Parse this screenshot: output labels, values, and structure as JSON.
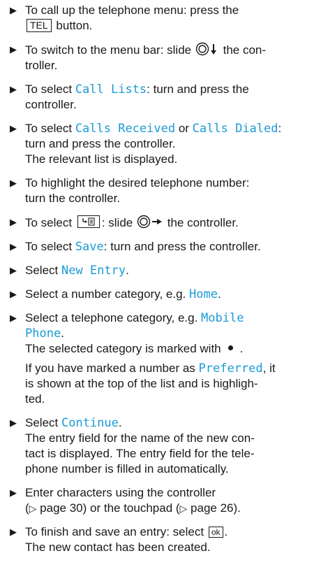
{
  "steps": [
    {
      "parts": [
        "To call up the telephone menu: press the",
        "TEL",
        "button."
      ]
    },
    {
      "parts": [
        "To switch to the menu bar: slide",
        "the con-",
        "troller."
      ]
    },
    {
      "parts": [
        "To select ",
        "Call Lists",
        ": turn and press the",
        "controller."
      ]
    },
    {
      "parts": [
        "To select ",
        "Calls Received",
        " or ",
        "Calls Dialed",
        ":",
        "turn and press the controller.",
        "The relevant list is displayed."
      ]
    },
    {
      "parts": [
        "To highlight the desired telephone number:",
        "turn the controller."
      ]
    },
    {
      "parts": [
        "To select",
        ": slide",
        "the controller."
      ]
    },
    {
      "parts": [
        "To select ",
        "Save",
        ": turn and press the controller."
      ]
    },
    {
      "parts": [
        "Select ",
        "New Entry",
        "."
      ]
    },
    {
      "parts": [
        "Select a number category, e.g. ",
        "Home",
        "."
      ]
    },
    {
      "parts": [
        "Select a telephone category, e.g. ",
        "Mobile",
        "Phone",
        ".",
        "The selected category is marked with",
        ".",
        "If you have marked a number as ",
        "Preferred",
        ", it",
        "is shown at the top of the list and is highligh-",
        "ted."
      ]
    },
    {
      "parts": [
        "Select ",
        "Continue",
        ".",
        "The entry field for the name of the new con-",
        "tact is displayed. The entry field for the tele-",
        "phone number is filled in automatically."
      ]
    },
    {
      "parts": [
        "Enter characters using the controller",
        "(",
        "▷",
        " page 30) or the touchpad (",
        "▷",
        " page 26)."
      ]
    },
    {
      "parts": [
        "To finish and save an entry: select",
        "ok",
        ".",
        "The new contact has been created."
      ]
    }
  ],
  "colors": {
    "highlight": "#1a9bd7",
    "text": "#1a1a1a"
  },
  "icons": {
    "bullet": "triangle-bullet-icon",
    "controller": "controller-icon",
    "menu_key": "phone-menu-key-icon"
  }
}
